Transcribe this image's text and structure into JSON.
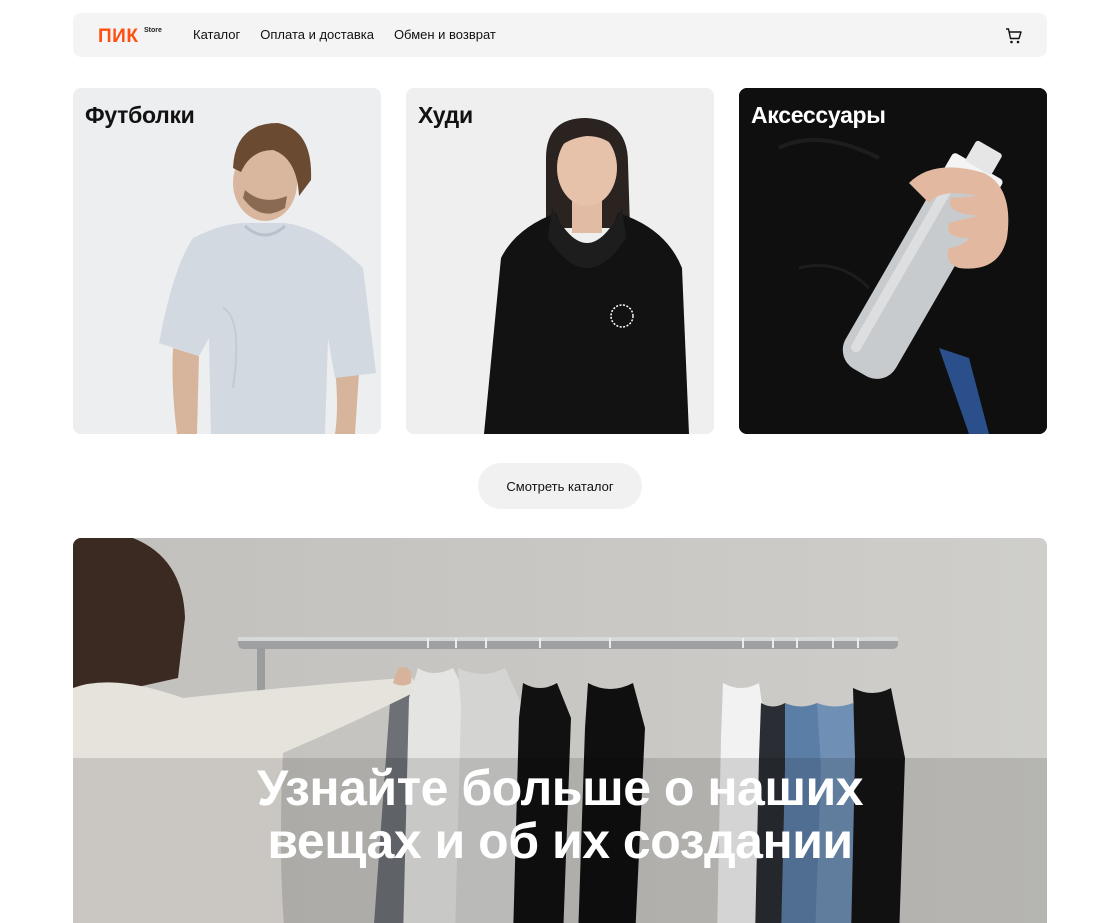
{
  "header": {
    "logo_main": "ПИК",
    "logo_sub": "Store",
    "nav": [
      {
        "label": "Каталог"
      },
      {
        "label": "Оплата и доставка"
      },
      {
        "label": "Обмен и возврат"
      }
    ],
    "cart_icon": "cart-icon"
  },
  "categories": [
    {
      "title": "Футболки",
      "bg": "#eceef0"
    },
    {
      "title": "Худи",
      "bg": "#efefef"
    },
    {
      "title": "Аксессуары",
      "bg": "#0f0f10"
    }
  ],
  "catalog_button": "Смотреть каталог",
  "banner": {
    "line1": "Узнайте больше о наших",
    "line2": "вещах и об их создании"
  },
  "colors": {
    "brand": "#ff4f12",
    "header_bg": "#f4f4f4",
    "button_bg": "#f1f1f1"
  }
}
